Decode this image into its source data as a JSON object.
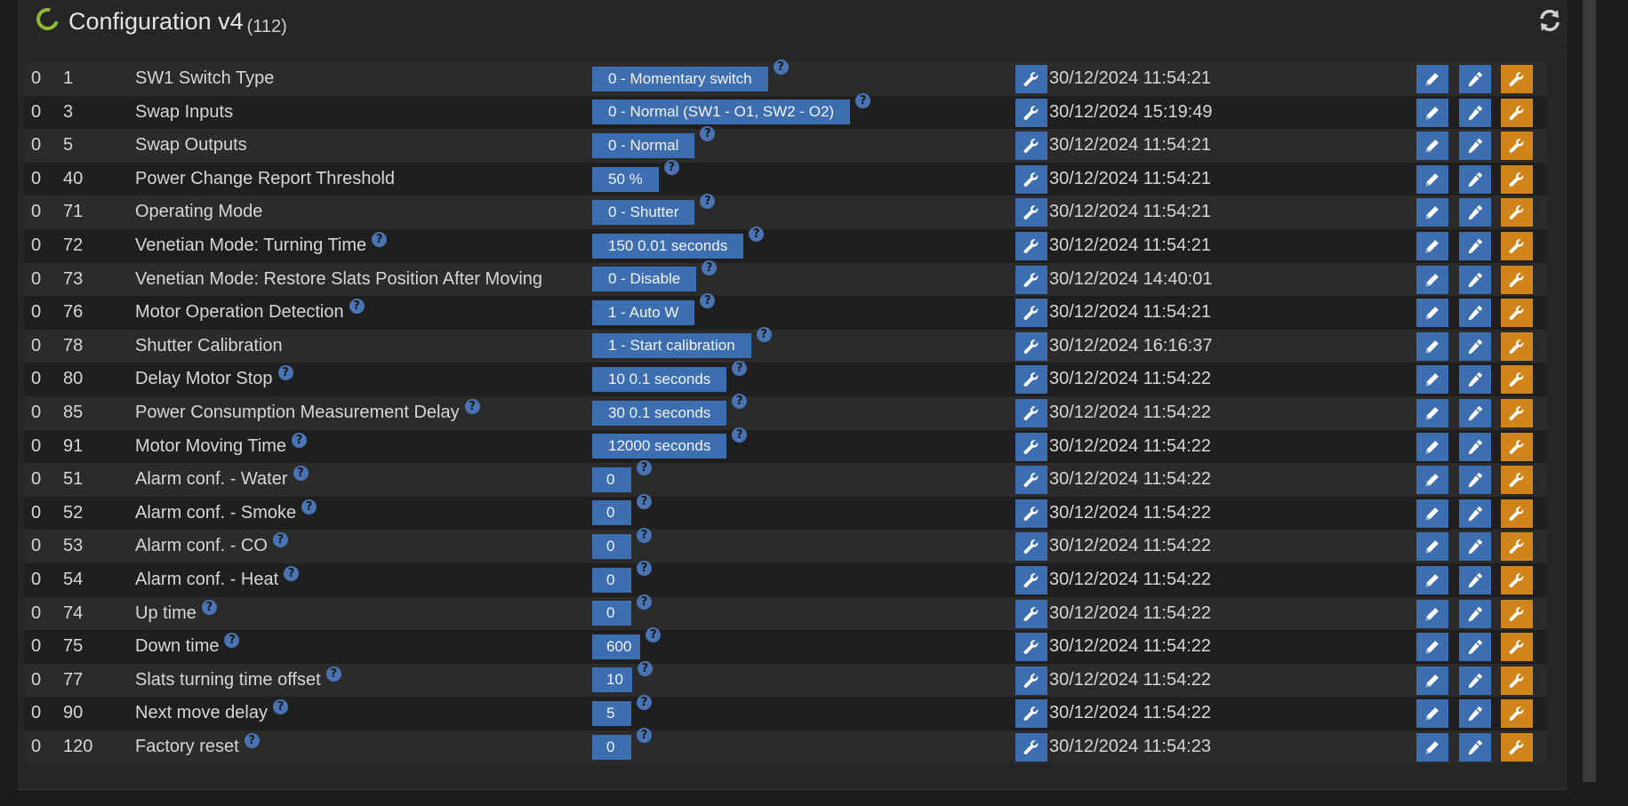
{
  "header": {
    "title": "Configuration v4",
    "count": "(112)"
  },
  "rows": [
    {
      "instance": "0",
      "id": "1",
      "name": "SW1 Switch Type",
      "name_help": false,
      "value": "0 - Momentary switch",
      "date": "30/12/2024 11:54:21"
    },
    {
      "instance": "0",
      "id": "3",
      "name": "Swap Inputs",
      "name_help": false,
      "value": "0 - Normal (SW1 - O1, SW2 - O2)",
      "date": "30/12/2024 15:19:49"
    },
    {
      "instance": "0",
      "id": "5",
      "name": "Swap Outputs",
      "name_help": false,
      "value": "0 - Normal",
      "date": "30/12/2024 11:54:21"
    },
    {
      "instance": "0",
      "id": "40",
      "name": "Power Change Report Threshold",
      "name_help": false,
      "value": "50 %",
      "date": "30/12/2024 11:54:21"
    },
    {
      "instance": "0",
      "id": "71",
      "name": "Operating Mode",
      "name_help": false,
      "value": "0 - Shutter",
      "date": "30/12/2024 11:54:21"
    },
    {
      "instance": "0",
      "id": "72",
      "name": "Venetian Mode: Turning Time",
      "name_help": true,
      "value": "150 0.01 seconds",
      "date": "30/12/2024 11:54:21"
    },
    {
      "instance": "0",
      "id": "73",
      "name": "Venetian Mode: Restore Slats Position After Moving",
      "name_help": false,
      "value": "0 - Disable",
      "date": "30/12/2024 14:40:01"
    },
    {
      "instance": "0",
      "id": "76",
      "name": "Motor Operation Detection",
      "name_help": true,
      "value": "1 - Auto W",
      "date": "30/12/2024 11:54:21"
    },
    {
      "instance": "0",
      "id": "78",
      "name": "Shutter Calibration",
      "name_help": false,
      "value": "1 - Start calibration",
      "date": "30/12/2024 16:16:37"
    },
    {
      "instance": "0",
      "id": "80",
      "name": "Delay Motor Stop",
      "name_help": true,
      "value": "10 0.1 seconds",
      "date": "30/12/2024 11:54:22"
    },
    {
      "instance": "0",
      "id": "85",
      "name": "Power Consumption Measurement Delay",
      "name_help": true,
      "value": "30 0.1 seconds",
      "date": "30/12/2024 11:54:22"
    },
    {
      "instance": "0",
      "id": "91",
      "name": "Motor Moving Time",
      "name_help": true,
      "value": "12000 seconds",
      "date": "30/12/2024 11:54:22"
    },
    {
      "instance": "0",
      "id": "51",
      "name": "Alarm conf. - Water",
      "name_help": true,
      "value": "0",
      "date": "30/12/2024 11:54:22"
    },
    {
      "instance": "0",
      "id": "52",
      "name": "Alarm conf. - Smoke",
      "name_help": true,
      "value": "0",
      "date": "30/12/2024 11:54:22"
    },
    {
      "instance": "0",
      "id": "53",
      "name": "Alarm conf. - CO",
      "name_help": true,
      "value": "0",
      "date": "30/12/2024 11:54:22"
    },
    {
      "instance": "0",
      "id": "54",
      "name": "Alarm conf. - Heat",
      "name_help": true,
      "value": "0",
      "date": "30/12/2024 11:54:22"
    },
    {
      "instance": "0",
      "id": "74",
      "name": "Up time",
      "name_help": true,
      "value": "0",
      "date": "30/12/2024 11:54:22"
    },
    {
      "instance": "0",
      "id": "75",
      "name": "Down time",
      "name_help": true,
      "value": "600",
      "date": "30/12/2024 11:54:22"
    },
    {
      "instance": "0",
      "id": "77",
      "name": "Slats turning time offset",
      "name_help": true,
      "value": "10",
      "date": "30/12/2024 11:54:22"
    },
    {
      "instance": "0",
      "id": "90",
      "name": "Next move delay",
      "name_help": true,
      "value": "5",
      "date": "30/12/2024 11:54:22"
    },
    {
      "instance": "0",
      "id": "120",
      "name": "Factory reset",
      "name_help": true,
      "value": "0",
      "date": "30/12/2024 11:54:23"
    }
  ],
  "help_glyph": "?",
  "colors": {
    "accent_blue": "#3d6fb0",
    "accent_orange": "#d0841a",
    "status_green": "#8cbb30"
  },
  "icons": {
    "header": [
      "loading-spinner-icon",
      "refresh-icon"
    ],
    "row_actions": [
      "wrench-icon",
      "pencil-icon",
      "eyedropper-icon",
      "wrench-icon"
    ]
  }
}
